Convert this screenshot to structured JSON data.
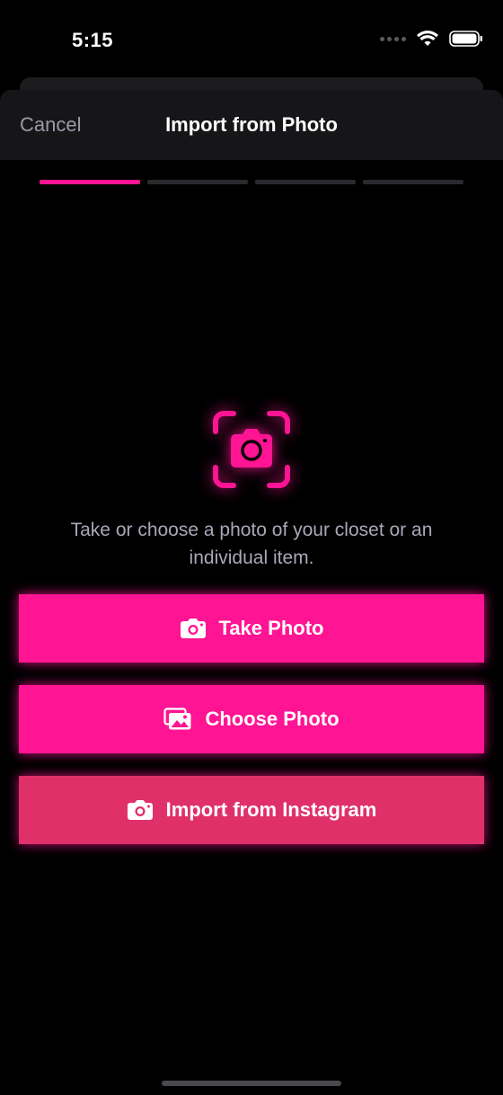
{
  "status_bar": {
    "time": "5:15",
    "icons": [
      "signal-icon",
      "wifi-icon",
      "battery-icon"
    ]
  },
  "nav": {
    "cancel_label": "Cancel",
    "title": "Import from Photo"
  },
  "progress": {
    "steps": 4,
    "current_step": 1
  },
  "hero": {
    "icon": "camera-scan-icon",
    "description": "Take or choose a photo of your closet or an individual item."
  },
  "actions": {
    "take_photo": "Take Photo",
    "choose_photo": "Choose Photo",
    "import_instagram": "Import from Instagram"
  },
  "colors": {
    "accent": "#ff1493",
    "instagram_button": "#e0306a",
    "background": "#000000",
    "nav_background": "#161618",
    "muted_text": "#a8a8b8"
  }
}
